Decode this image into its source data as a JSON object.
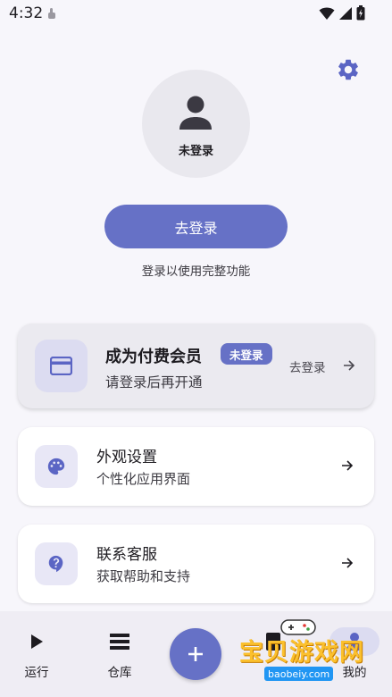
{
  "status_bar": {
    "time": "4:32"
  },
  "profile": {
    "avatar_label": "未登录"
  },
  "login": {
    "button_label": "去登录",
    "hint": "登录以使用完整功能"
  },
  "membership_card": {
    "title": "成为付费会员",
    "badge": "未登录",
    "subtitle": "请登录后再开通",
    "action": "去登录"
  },
  "settings_rows": [
    {
      "title": "外观设置",
      "subtitle": "个性化应用界面",
      "icon": "palette-icon"
    },
    {
      "title": "联系客服",
      "subtitle": "获取帮助和支持",
      "icon": "help-icon"
    }
  ],
  "bottom_nav": {
    "items": [
      {
        "label": "运行",
        "icon": "play-icon"
      },
      {
        "label": "仓库",
        "icon": "list-icon"
      },
      {
        "label": "",
        "icon": "document-icon"
      },
      {
        "label": "我的",
        "icon": "person-icon"
      }
    ],
    "fab_icon": "plus-icon",
    "selected": "我的"
  },
  "watermark": {
    "text": "宝贝游戏网",
    "url": "baobeiy.com"
  },
  "colors": {
    "accent": "#6671c6",
    "background": "#f7f6fb",
    "card": "#ffffff",
    "member_card": "#ebeaf0",
    "icon_tint": "#dcdcf1"
  }
}
